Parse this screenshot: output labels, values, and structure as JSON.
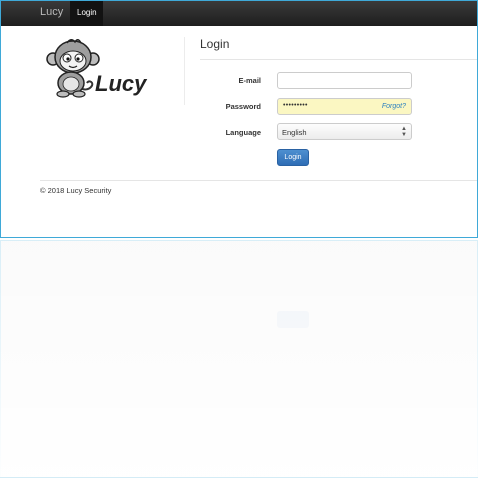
{
  "navbar": {
    "brand": "Lucy",
    "active_tab": "Login"
  },
  "logo": {
    "text": "Lucy",
    "mascot": "monkey-mascot"
  },
  "form": {
    "heading": "Login",
    "email_label": "E-mail",
    "email_value": "",
    "password_label": "Password",
    "password_value": "•••••••••",
    "forgot_link": "Forgot?",
    "language_label": "Language",
    "language_selected": "English",
    "submit_label": "Login"
  },
  "footer": {
    "copyright": "© 2018 Lucy Security"
  },
  "colors": {
    "navbar": "#222222",
    "accent": "#2e6db5",
    "autofill": "#fbf7c2",
    "frame_border": "#3fa9d8"
  }
}
